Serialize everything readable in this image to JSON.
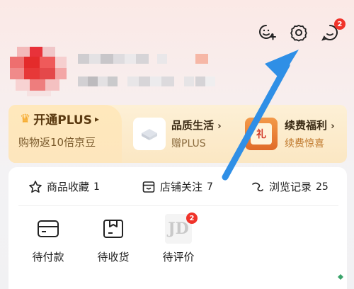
{
  "header": {
    "add_friend_icon": "person-add-icon",
    "settings_icon": "gear-icon",
    "messages_icon": "chat-icon",
    "messages_badge": "2"
  },
  "plus": {
    "title": "开通PLUS",
    "subtitle": "购物返10倍京豆",
    "quality_title": "品质生活",
    "quality_sub": "赠PLUS",
    "renew_title": "续费福利",
    "renew_sub": "续费惊喜",
    "renew_glyph": "礼"
  },
  "stats": [
    {
      "label": "商品收藏",
      "count": "1",
      "icon": "star-icon"
    },
    {
      "label": "店铺关注",
      "count": "7",
      "icon": "shop-icon"
    },
    {
      "label": "浏览记录",
      "count": "25",
      "icon": "footprint-icon"
    }
  ],
  "orders": [
    {
      "label": "待付款",
      "icon": "wallet-icon"
    },
    {
      "label": "待收货",
      "icon": "package-icon"
    },
    {
      "label": "待评价",
      "icon": "jd-thumb",
      "badge": "2",
      "thumb_text": "JD"
    }
  ],
  "colors": {
    "badge": "#f0332a",
    "arrow": "#2f8fe6",
    "plus_bg": "#fbe7c3"
  }
}
